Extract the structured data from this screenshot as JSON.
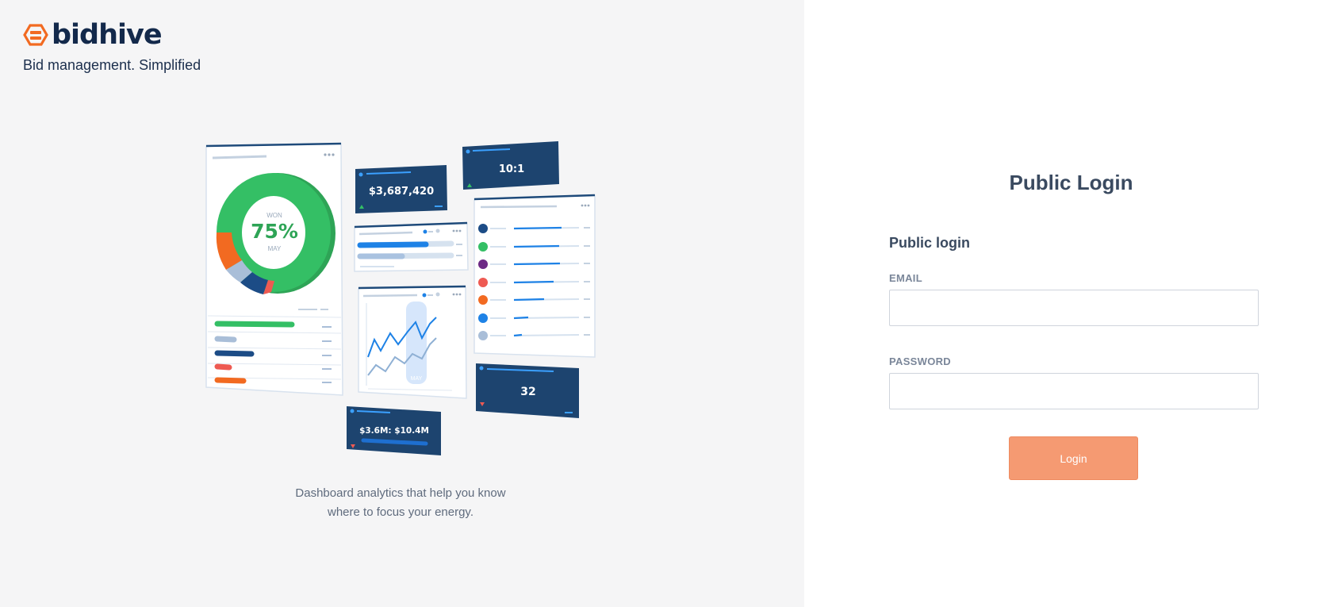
{
  "brand": {
    "name": "bidhive",
    "tagline": "Bid management. Simplified",
    "accent_color": "#f26a21",
    "text_color": "#13294b"
  },
  "illustration": {
    "donut_label_top": "WON",
    "donut_value": "75%",
    "donut_label_bottom": "MAY",
    "card_total": "$3,687,420",
    "card_ratio": "10:1",
    "card_count": "32",
    "card_range": "$3.6M: $10.4M",
    "line_chart_label": "MAY"
  },
  "caption": {
    "line1": "Dashboard analytics that help you know",
    "line2": "where to focus your energy."
  },
  "login": {
    "title": "Public Login",
    "section_title": "Public login",
    "email_label": "EMAIL",
    "email_value": "",
    "email_placeholder": "",
    "password_label": "PASSWORD",
    "password_value": "",
    "password_placeholder": "",
    "button_label": "Login",
    "button_color": "#f59a72"
  }
}
